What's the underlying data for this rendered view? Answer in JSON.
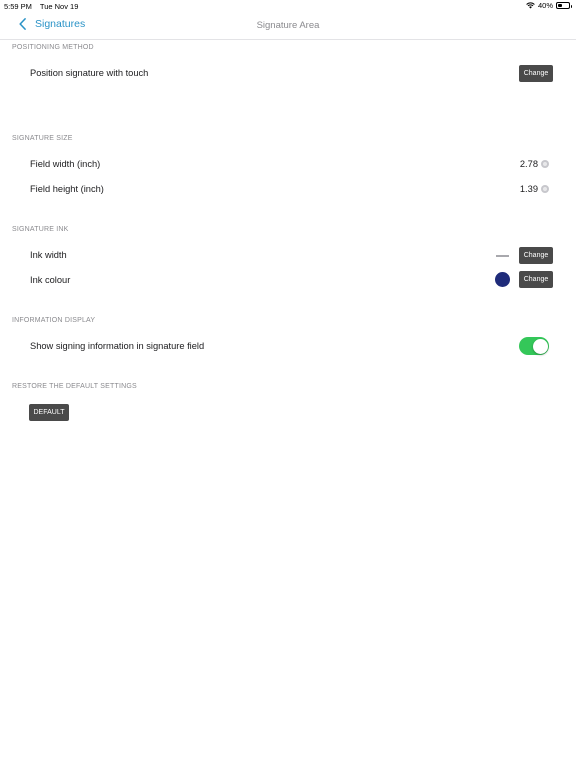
{
  "status_bar": {
    "time": "5:59 PM",
    "date": "Tue Nov 19",
    "battery": "40%"
  },
  "nav": {
    "back_label": "Signatures",
    "title": "Signature Area"
  },
  "sections": {
    "positioning": {
      "header": "POSITIONING METHOD",
      "position_label": "Position signature with touch",
      "change_label": "Change"
    },
    "size": {
      "header": "SIGNATURE SIZE",
      "width_label": "Field width (inch)",
      "width_value": "2.78",
      "height_label": "Field height (inch)",
      "height_value": "1.39"
    },
    "ink": {
      "header": "SIGNATURE INK",
      "width_label": "Ink width",
      "width_change_label": "Change",
      "colour_label": "Ink colour",
      "colour_change_label": "Change",
      "colour": "#1f2b7a"
    },
    "info": {
      "header": "INFORMATION DISPLAY",
      "show_label": "Show signing information in signature field",
      "toggle_on": true
    },
    "restore": {
      "header": "RESTORE THE DEFAULT SETTINGS",
      "default_label": "DEFAULT"
    }
  },
  "colors": {
    "accent": "#2a93c7",
    "button": "#4a4a4a",
    "toggle_on": "#34c759"
  }
}
